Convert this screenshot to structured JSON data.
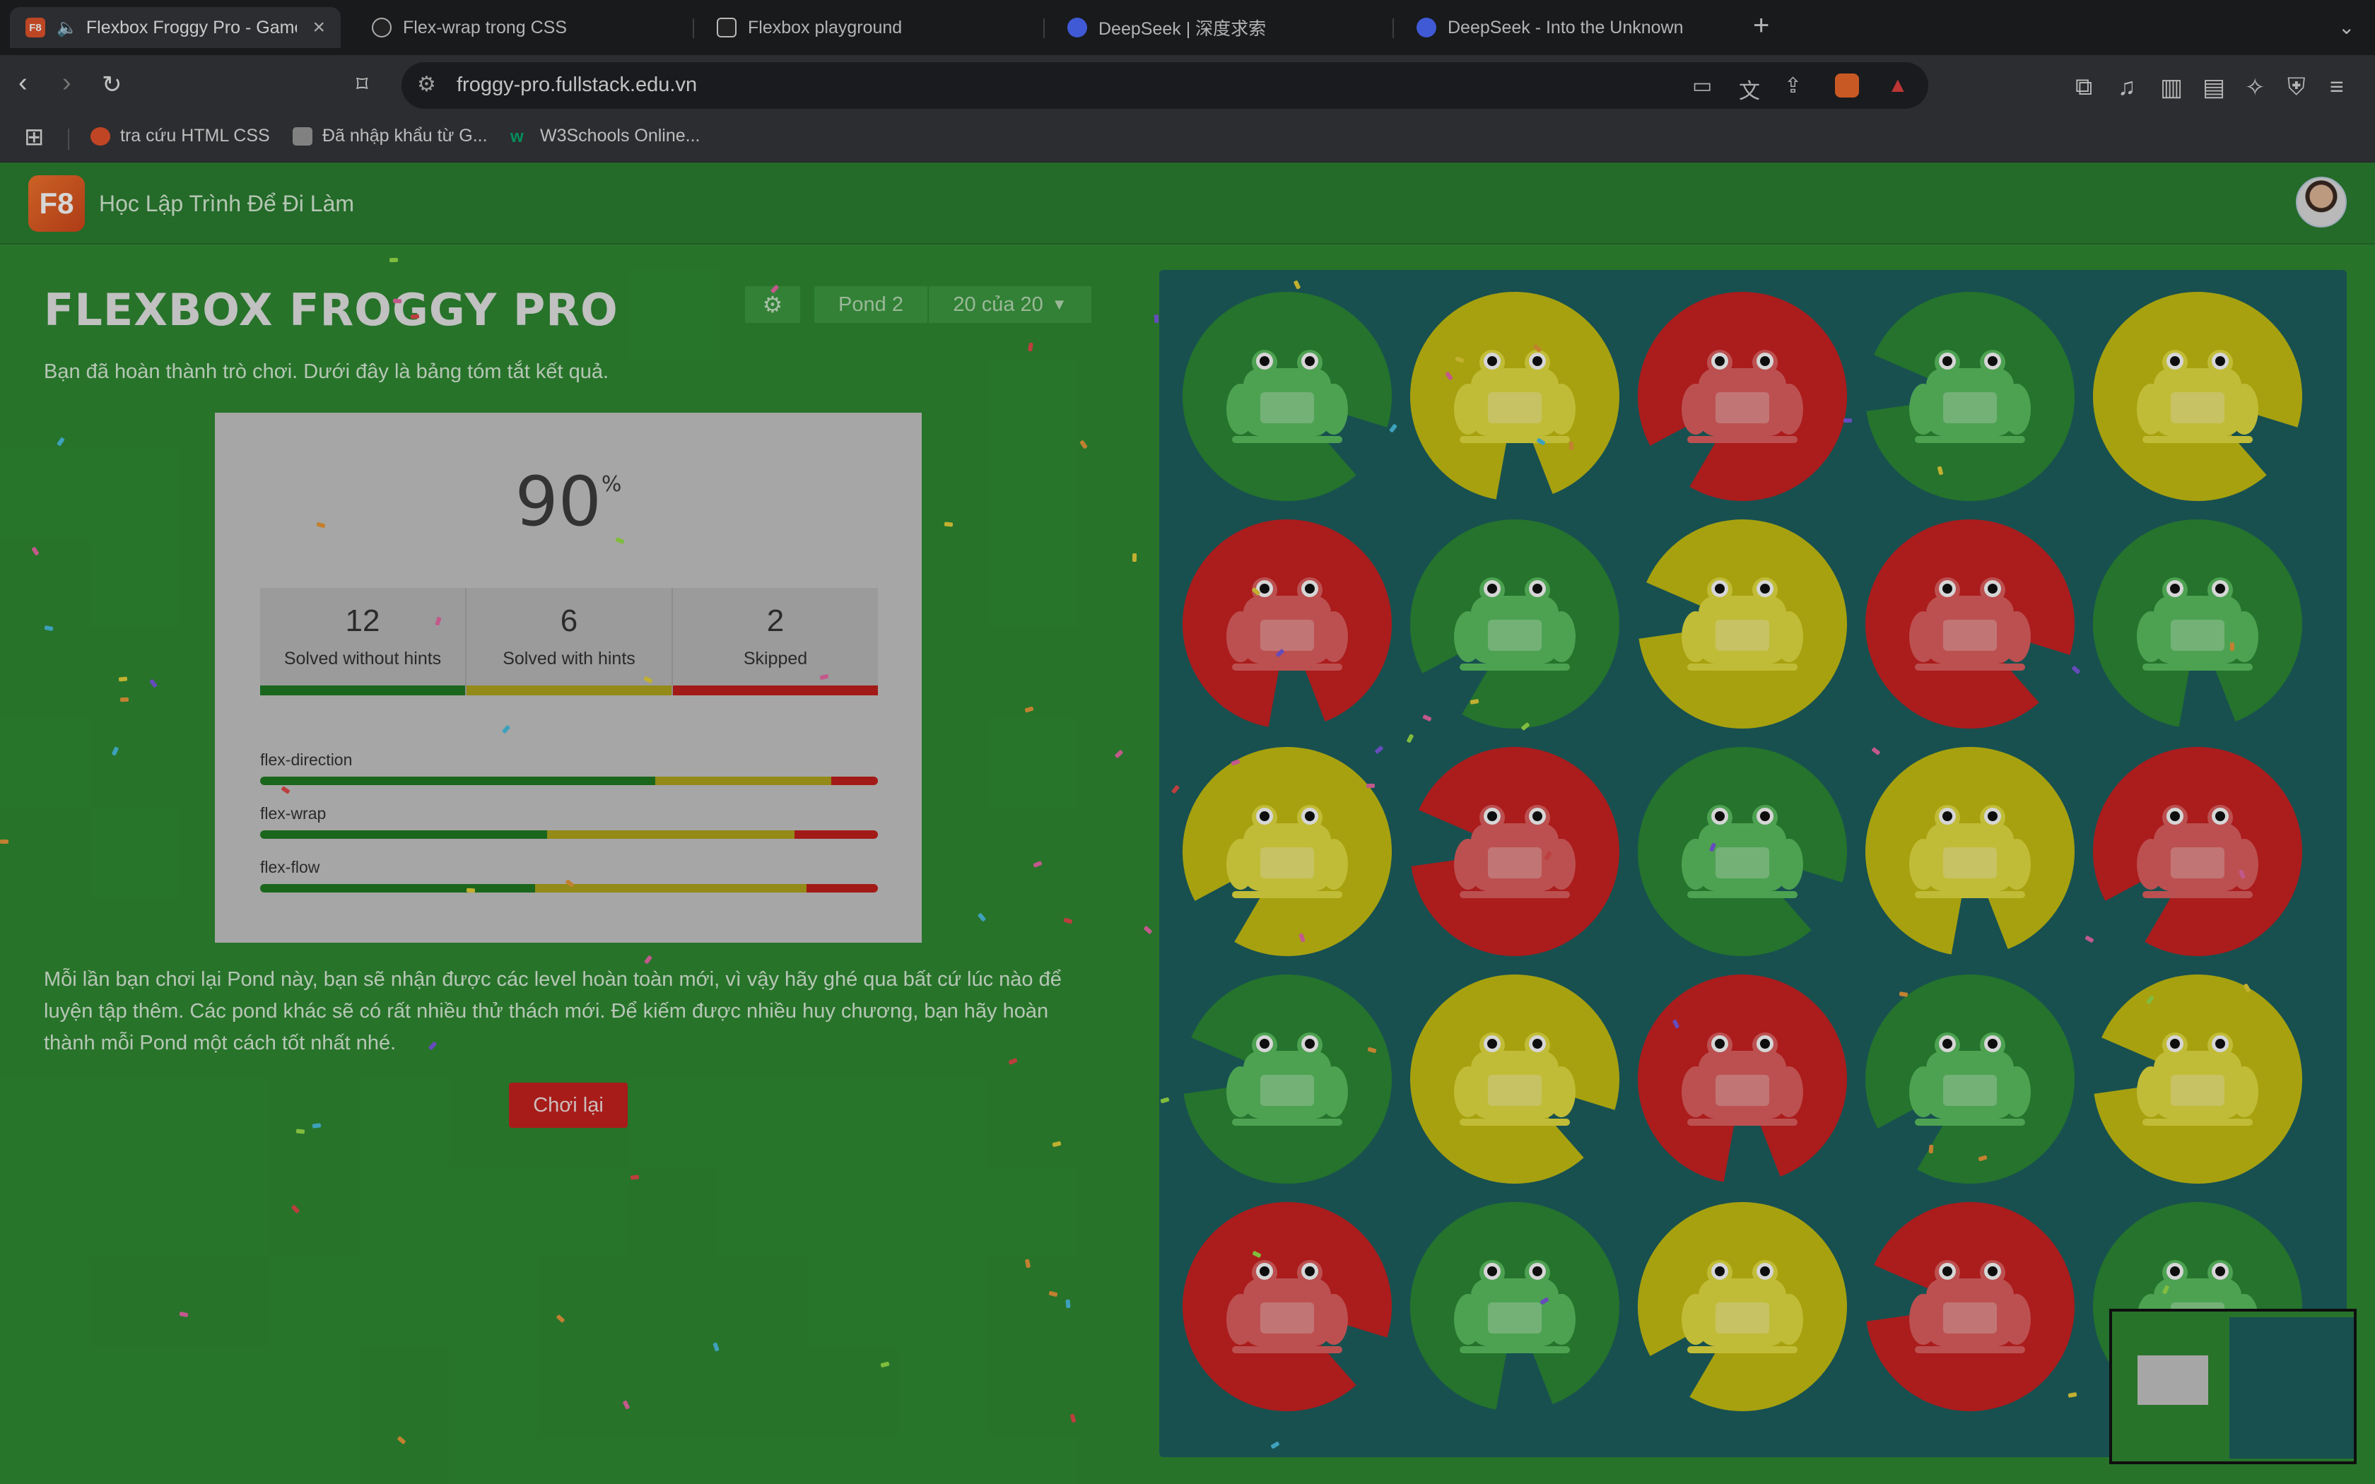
{
  "browser": {
    "tabs": [
      {
        "title": "Flexbox Froggy Pro - Game",
        "favicon": "F8",
        "favicon_color": "#e2542b",
        "active": true,
        "audio": true
      },
      {
        "title": "Flex-wrap trong CSS",
        "favicon": "openai-icon",
        "favicon_color": "#2a2a2a",
        "active": false
      },
      {
        "title": "Flexbox playground",
        "favicon": "codepen-icon",
        "favicon_color": "#2a2a2a",
        "active": false
      },
      {
        "title": "DeepSeek | 深度求索",
        "favicon": "deepseek-icon",
        "favicon_color": "#4d6bfe",
        "active": false
      },
      {
        "title": "DeepSeek - Into the Unknown",
        "favicon": "deepseek-icon",
        "favicon_color": "#4d6bfe",
        "active": false
      }
    ],
    "url": "froggy-pro.fullstack.edu.vn",
    "bookmarks": [
      {
        "label": "tra cứu HTML CSS",
        "icon": "red-dot-icon"
      },
      {
        "label": "Đã nhập khẩu từ G...",
        "icon": "folder-icon"
      },
      {
        "label": "W3Schools Online...",
        "icon": "w3schools-icon"
      }
    ]
  },
  "site": {
    "logo": "F8",
    "tagline": "Học Lập Trình Để Đi Làm"
  },
  "game": {
    "title": "FLEXBOX FROGGY PRO",
    "pond_label": "Pond 2",
    "level_label": "20 của 20",
    "intro": "Bạn đã hoàn thành trò chơi. Dưới đây là bảng tóm tắt kết quả.",
    "result": {
      "percent": "90",
      "percent_sign": "%",
      "stats": [
        {
          "value": "12",
          "label": "Solved without hints",
          "color": "#1f7a22"
        },
        {
          "value": "6",
          "label": "Solved with hints",
          "color": "#b0a51c"
        },
        {
          "value": "2",
          "label": "Skipped",
          "color": "#c2201c"
        }
      ],
      "properties": [
        {
          "name": "flex-direction",
          "solved": 0.64,
          "hints": 0.285,
          "skipped": 0.075
        },
        {
          "name": "flex-wrap",
          "solved": 0.465,
          "hints": 0.4,
          "skipped": 0.135
        },
        {
          "name": "flex-flow",
          "solved": 0.445,
          "hints": 0.44,
          "skipped": 0.115
        }
      ]
    },
    "outro": "Mỗi lần bạn chơi lại Pond này, bạn sẽ nhận được các level hoàn toàn mới, vì vậy hãy ghé qua bất cứ lúc nào để luyện tập thêm. Các pond khác sẽ có rất nhiều thử thách mới. Để kiếm được nhiều huy chương, bạn hãy hoàn thành mỗi Pond một cách tốt nhất nhé.",
    "replay_label": "Chơi lại",
    "pond_colors": {
      "green": {
        "pad": "#2d8a35",
        "frog": "#5cc262"
      },
      "yellow": {
        "pad": "#c7c013",
        "frog": "#e6e042"
      },
      "red": {
        "pad": "#cc2222",
        "frog": "#e06060"
      }
    },
    "pond_grid": [
      [
        "green",
        "yellow",
        "red",
        "green",
        "yellow"
      ],
      [
        "red",
        "green",
        "yellow",
        "red",
        "green"
      ],
      [
        "yellow",
        "red",
        "green",
        "yellow",
        "red"
      ],
      [
        "green",
        "yellow",
        "red",
        "green",
        "yellow"
      ],
      [
        "red",
        "green",
        "yellow",
        "red",
        "green"
      ]
    ]
  }
}
